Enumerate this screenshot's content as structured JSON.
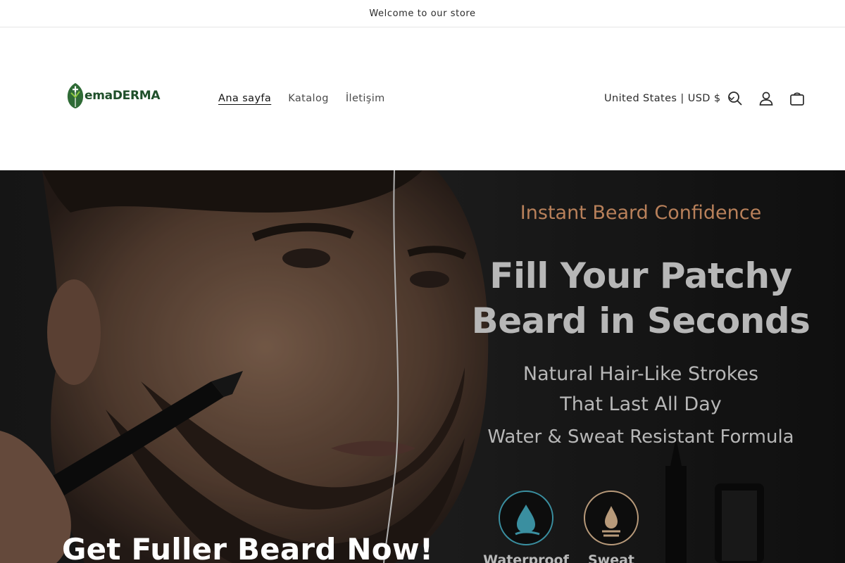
{
  "announcement": {
    "text": "Welcome to our store"
  },
  "header": {
    "logo_text": "emaDERMA",
    "nav": [
      {
        "label": "Ana sayfa",
        "active": true
      },
      {
        "label": "Katalog",
        "active": false
      },
      {
        "label": "İletişim",
        "active": false
      }
    ],
    "country_selector": "United States | USD $",
    "icons": [
      "search-icon",
      "account-icon",
      "cart-icon",
      "chevron-down-icon"
    ]
  },
  "hero": {
    "eyebrow": "Instant Beard Confidence",
    "headline_line1": "Fill Your Patchy",
    "headline_line2": "Beard in Seconds",
    "sub_line1": "Natural Hair-Like Strokes",
    "sub_line2": "That Last All Day",
    "formula": "Water & Sweat Resistant Formula",
    "badge_1_label": "Waterproof",
    "badge_2_label": "Sweat",
    "heading": "Get Fuller Beard Now!"
  },
  "colors": {
    "accent_copper": "#b8805a",
    "logo_green": "#1f4f2a",
    "badge_teal": "#3a8fa0",
    "badge_tan": "#b89a7a"
  }
}
